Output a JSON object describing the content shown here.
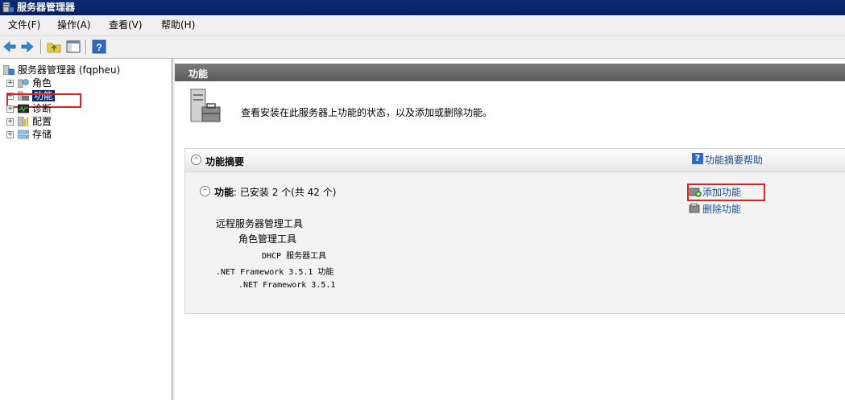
{
  "window": {
    "title": "服务器管理器"
  },
  "menu": [
    "文件(F)",
    "操作(A)",
    "查看(V)",
    "帮助(H)"
  ],
  "toolbar": {
    "buttons": [
      "back-icon",
      "forward-icon",
      "up-folder-icon",
      "show-hide-tree-icon",
      "help-icon"
    ]
  },
  "tree": {
    "root": "服务器管理器 (fqpheu)",
    "items": [
      {
        "label": "角色",
        "icon": "roles-icon"
      },
      {
        "label": "功能",
        "icon": "features-icon",
        "selected": true
      },
      {
        "label": "诊断",
        "icon": "diagnostics-icon"
      },
      {
        "label": "配置",
        "icon": "configuration-icon"
      },
      {
        "label": "存储",
        "icon": "storage-icon"
      }
    ]
  },
  "content": {
    "header": "功能",
    "description": "查看安装在此服务器上功能的状态，以及添加或删除功能。",
    "summary": {
      "title": "功能摘要",
      "help_link": "功能摘要帮助",
      "features_label": "功能",
      "features_status": ": 已安装 2 个(共 42 个)",
      "installed": [
        "远程服务器管理工具",
        "角色管理工具",
        "DHCP 服务器工具",
        ".NET Framework 3.5.1 功能",
        ".NET Framework 3.5.1"
      ],
      "actions": {
        "add": "添加功能",
        "remove": "删除功能"
      }
    }
  },
  "colors": {
    "highlight_box": "#e0201e",
    "link": "#1a4d9c",
    "titlebar": "#0b2b73"
  }
}
